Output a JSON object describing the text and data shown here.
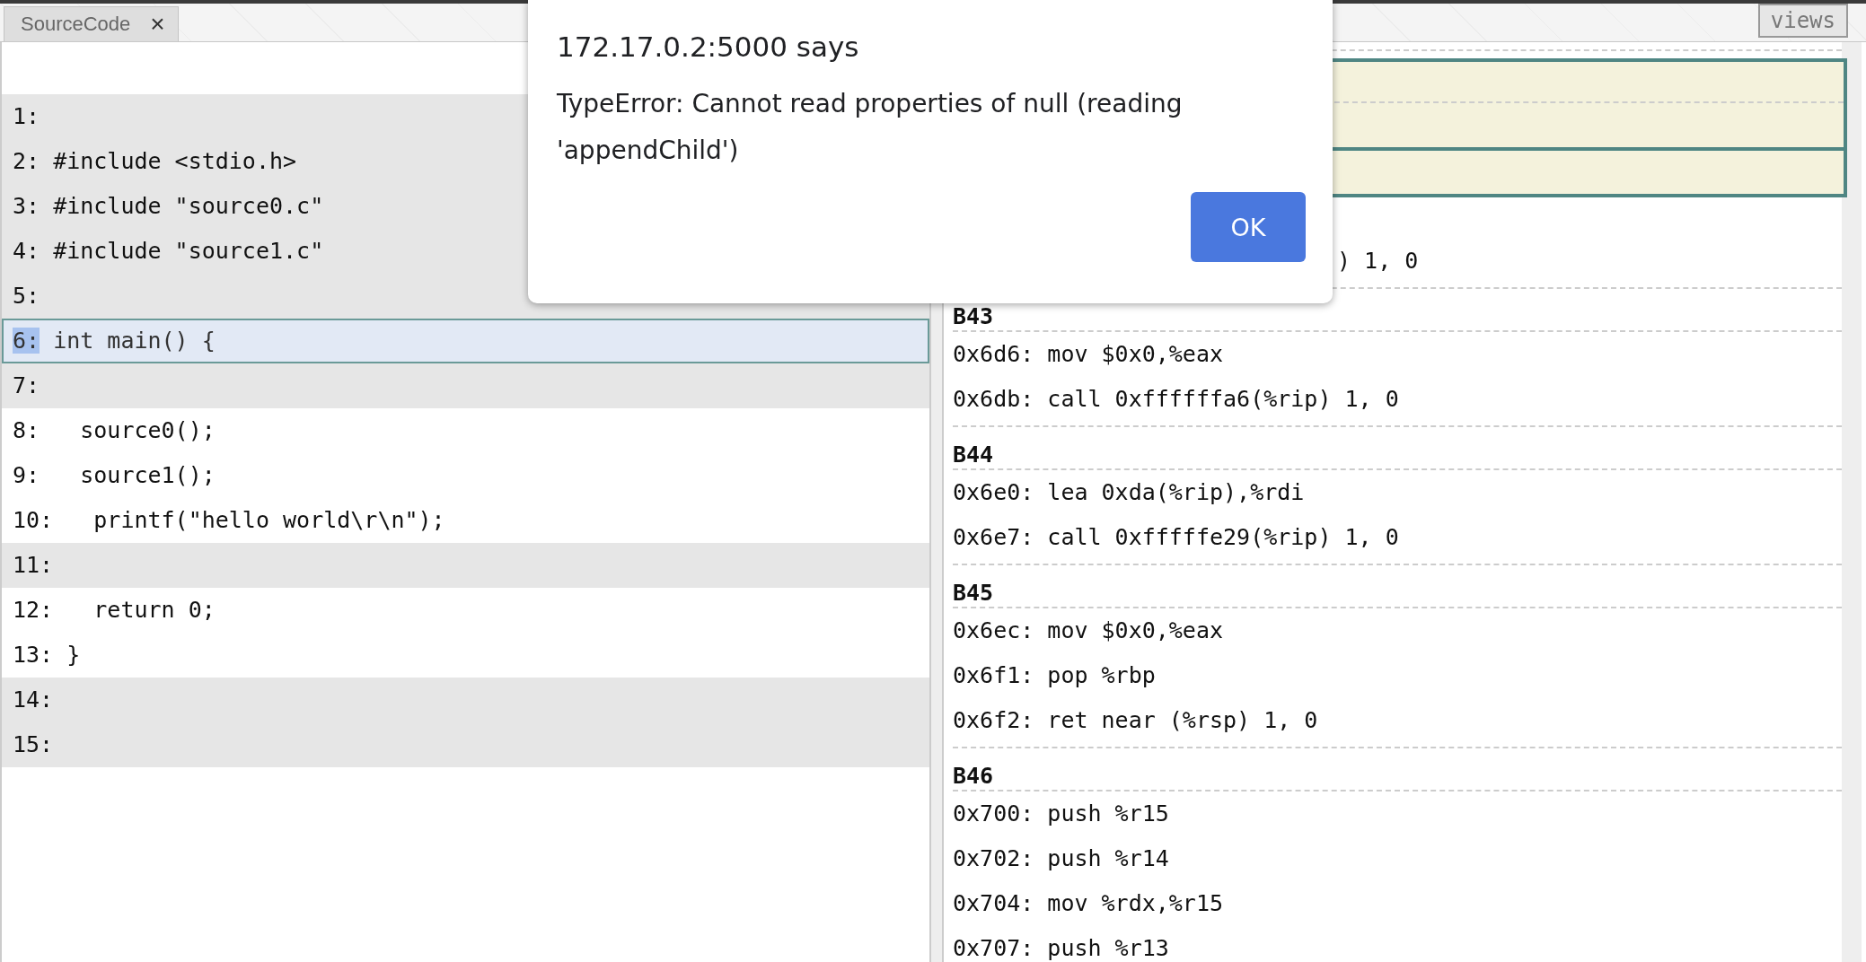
{
  "tabs": [
    {
      "label": "SourceCode",
      "close": "×",
      "selected": true
    }
  ],
  "views_button": {
    "label": "views"
  },
  "source_lines": [
    {
      "text": "1:",
      "shaded": true,
      "selected": false
    },
    {
      "text": "2: #include <stdio.h>",
      "shaded": true,
      "selected": false
    },
    {
      "text": "3: #include \"source0.c\"",
      "shaded": true,
      "selected": false
    },
    {
      "text": "4: #include \"source1.c\"",
      "shaded": true,
      "selected": false
    },
    {
      "text": "5:",
      "shaded": true,
      "selected": false
    },
    {
      "text": "6: int main() {",
      "shaded": false,
      "selected": true
    },
    {
      "text": "7:",
      "shaded": true,
      "selected": false
    },
    {
      "text": "8:   source0();",
      "shaded": false,
      "selected": false
    },
    {
      "text": "9:   source1();",
      "shaded": false,
      "selected": false
    },
    {
      "text": "10:   printf(\"hello world\\r\\n\");",
      "shaded": false,
      "selected": false
    },
    {
      "text": "11:",
      "shaded": true,
      "selected": false
    },
    {
      "text": "12:   return 0;",
      "shaded": false,
      "selected": false
    },
    {
      "text": "13: }",
      "shaded": false,
      "selected": false
    },
    {
      "text": "14:",
      "shaded": true,
      "selected": false
    },
    {
      "text": "15:",
      "shaded": true,
      "selected": false
    }
  ],
  "blocks": [
    {
      "lines": [
        ") 1, 0"
      ]
    },
    {
      "header": "B43",
      "lines": [
        "0x6d6: mov $0x0,%eax",
        "0x6db: call 0xffffffa6(%rip) 1, 0"
      ]
    },
    {
      "header": "B44",
      "lines": [
        "0x6e0: lea 0xda(%rip),%rdi",
        "0x6e7: call 0xfffffe29(%rip) 1, 0"
      ]
    },
    {
      "header": "B45",
      "lines": [
        "0x6ec: mov $0x0,%eax",
        "0x6f1: pop %rbp",
        "0x6f2: ret near (%rsp) 1, 0"
      ]
    },
    {
      "header": "B46",
      "lines": [
        "0x700: push %r15",
        "0x702: push %r14",
        "0x704: mov %rdx,%r15",
        "0x707: push %r13"
      ]
    }
  ],
  "dialog": {
    "title": "172.17.0.2:5000 says",
    "message": "TypeError: Cannot read properties of null (reading 'appendChild')",
    "button": "OK"
  }
}
